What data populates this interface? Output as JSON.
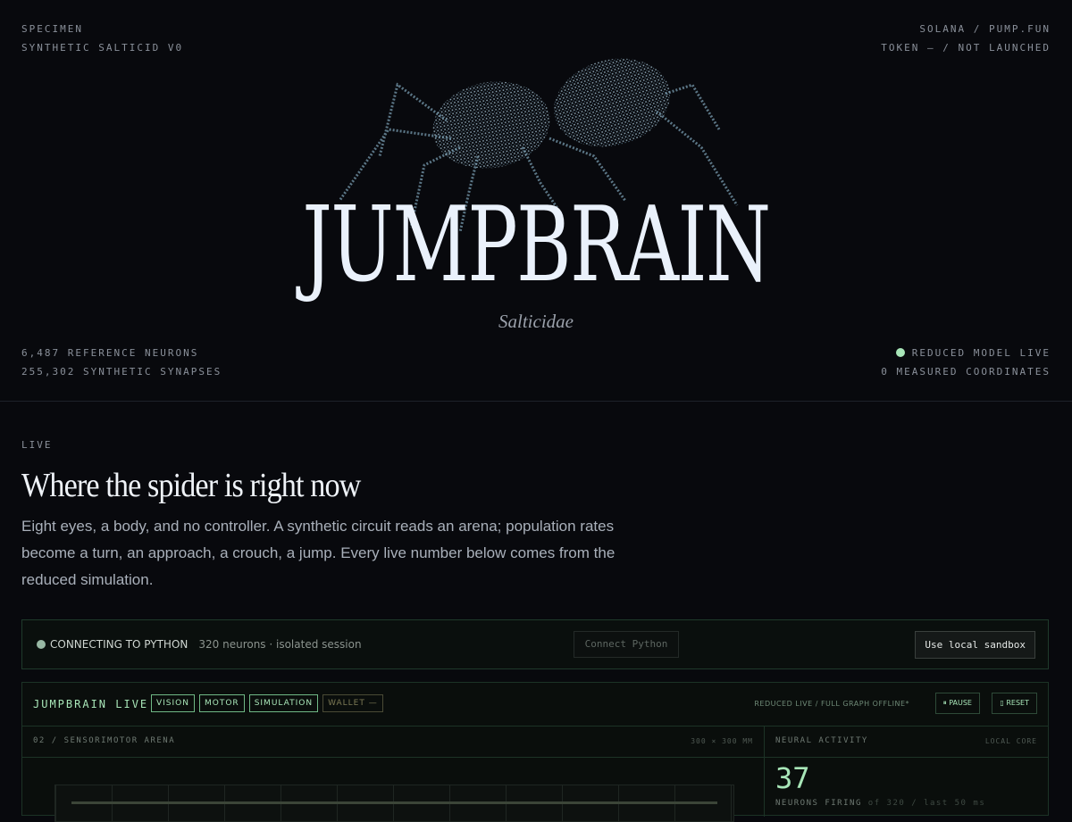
{
  "specimen": {
    "label": "SPECIMEN",
    "name": "SYNTHETIC SALTICID V0"
  },
  "platform": {
    "chain": "SOLANA / PUMP.FUN",
    "token": "TOKEN — / NOT LAUNCHED"
  },
  "hero": {
    "title": "JUMPBRAIN",
    "subtitle": "Salticidae",
    "image": "spider-particle-render"
  },
  "stats_left": {
    "neurons": "6,487 REFERENCE NEURONS",
    "synapses": "255,302 SYNTHETIC SYNAPSES"
  },
  "stats_right": {
    "status": "REDUCED MODEL LIVE",
    "coords": "0 MEASURED COORDINATES",
    "status_color": "#a8e6b8"
  },
  "live": {
    "eyebrow": "LIVE",
    "heading": "Where the spider is right now",
    "lede": "Eight eyes, a body, and no controller. A synthetic circuit reads an arena; population rates become a turn, an approach, a crouch, a jump. Every live number below comes from the reduced simulation."
  },
  "connection": {
    "status": "CONNECTING TO PYTHON",
    "meta": "320 neurons · isolated session",
    "connect_button": "Connect Python",
    "sandbox_button": "Use local sandbox"
  },
  "panel": {
    "brand": "JUMPBRAIN LIVE",
    "tabs": [
      {
        "label": "VISION"
      },
      {
        "label": "MOTOR"
      },
      {
        "label": "SIMULATION"
      },
      {
        "label": "WALLET —"
      }
    ],
    "mode": "REDUCED LIVE / FULL GRAPH OFFLINE*",
    "pause": "⏸ PAUSE",
    "reset": "▯ RESET",
    "arena_label": "02 / SENSORIMOTOR ARENA",
    "arena_dims": "300 × 300 MM",
    "activity_label": "NEURAL ACTIVITY",
    "activity_note": "LOCAL CORE",
    "firing_count": "37",
    "firing_label": "NEURONS FIRING",
    "firing_detail": "of 320 / last 50 ms"
  }
}
